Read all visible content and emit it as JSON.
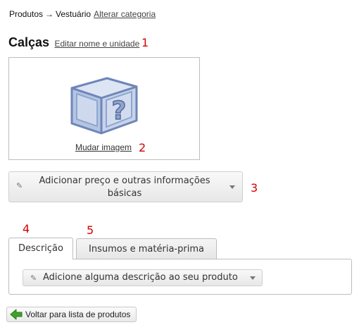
{
  "breadcrumb": {
    "category": "Produtos",
    "separator": "→",
    "subcategory": "Vestuário",
    "change_category_link": "Alterar categoria"
  },
  "product": {
    "name": "Calças",
    "edit_link": "Editar nome e unidade"
  },
  "image_box": {
    "placeholder_icon": "unknown-product-box-icon",
    "change_image_link": "Mudar imagem"
  },
  "price_button": {
    "icon": "pencil-icon",
    "label_line1": "Adicionar preço e outras informações",
    "label_line2": "básicas"
  },
  "tabs": [
    {
      "label": "Descrição",
      "active": true
    },
    {
      "label": "Insumos e matéria-prima",
      "active": false
    }
  ],
  "description_button": {
    "icon": "pencil-icon",
    "label": "Adicione alguma descrição ao seu produto"
  },
  "back_button": {
    "icon": "green-left-arrow-icon",
    "label": "Voltar para lista de produtos"
  },
  "annotations": [
    "1",
    "2",
    "3",
    "4",
    "5"
  ],
  "colors": {
    "annotation": "#d40000",
    "back_arrow": "#3fa12a",
    "box_icon": "#8ea6cf"
  }
}
